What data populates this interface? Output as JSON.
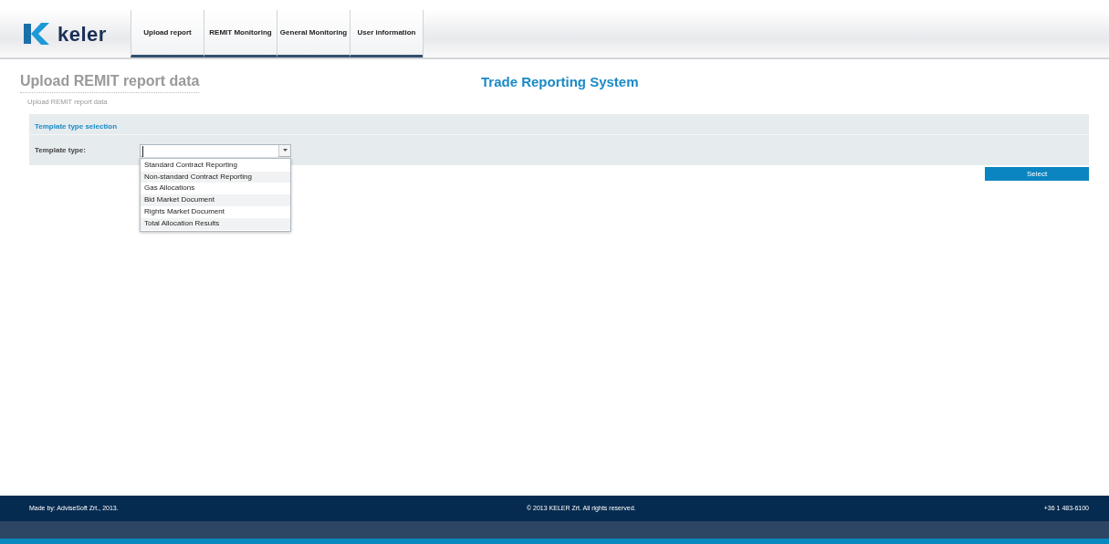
{
  "header": {
    "logo_text": "keler",
    "tabs": [
      {
        "label": "Upload report"
      },
      {
        "label": "REMIT Monitoring"
      },
      {
        "label": "General Monitoring"
      },
      {
        "label": "User information"
      }
    ]
  },
  "page": {
    "title": "Upload REMIT report data",
    "breadcrumb": "Upload REMIT report data",
    "system_title": "Trade Reporting System"
  },
  "panel": {
    "heading": "Template type selection",
    "field_label": "Template type:",
    "expanded": true,
    "options": [
      {
        "label": "Standard Contract Reporting"
      },
      {
        "label": "Non-standard Contract Reporting"
      },
      {
        "label": "Gas Allocations"
      },
      {
        "label": "Bid Market Document"
      },
      {
        "label": "Rights Market Document"
      },
      {
        "label": "Total Allocation Results"
      }
    ]
  },
  "select_button": "Select",
  "footer": {
    "made_by": "Made by: AdviseSoft Zrt., 2013.",
    "copyright": "© 2013 KELER Zrt. All rights reserved.",
    "phone": "+36 1 483-6100"
  }
}
